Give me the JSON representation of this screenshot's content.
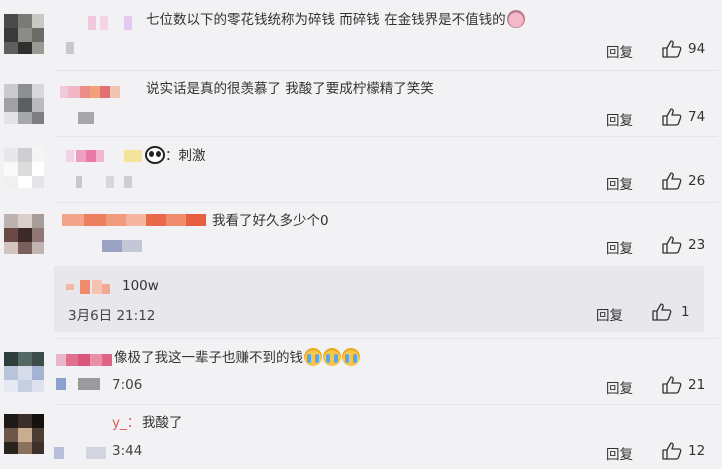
{
  "comments": [
    {
      "text": "七位数以下的零花钱统称为碎钱 而碎钱 在金钱界是不值钱的",
      "emoji": "pig-icon",
      "reply": "回复",
      "likes": "94"
    },
    {
      "text": "说实话是真的很羡慕了 我酸了要成柠檬精了笑笑",
      "reply": "回复",
      "likes": "74"
    },
    {
      "text": "：刺激",
      "emoji": "panda-icon",
      "reply": "回复",
      "likes": "26"
    },
    {
      "text": "我看了好久多少个0",
      "reply": "回复",
      "likes": "23"
    },
    {
      "text": "像极了我这一辈子也赚不到的钱",
      "emoji": "cry-icon",
      "time_fragment": "7:06",
      "reply": "回复",
      "likes": "21"
    },
    {
      "text": "我酸了",
      "nick_fragment": "y_：",
      "time_fragment": "3:44",
      "reply": "回复",
      "likes": "12"
    }
  ],
  "sub_reply": {
    "text": "100w",
    "time": "3月6日 21:12",
    "reply": "回复",
    "likes": "1"
  },
  "colors": {
    "background": "#f2f2f5",
    "sub_background": "#e8e8ec",
    "text": "#333333",
    "divider": "#e3e3e8"
  }
}
